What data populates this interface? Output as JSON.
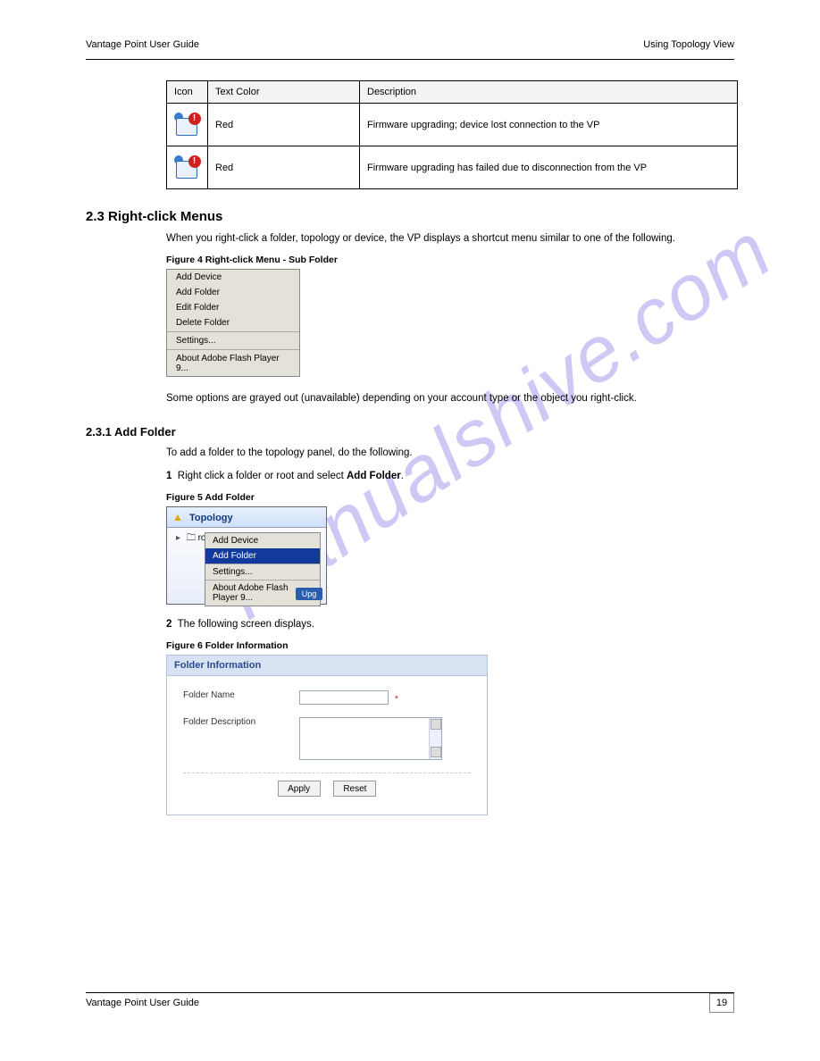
{
  "header": {
    "left": "Vantage Point User Guide",
    "right": "Using Topology View"
  },
  "footer": {
    "left": "Vantage Point User Guide",
    "pageno": "19"
  },
  "table": {
    "h1": "Icon",
    "h2": "Text Color",
    "h3": "Description",
    "rows": [
      {
        "c2": "Red",
        "c3": "Firmware upgrading; device lost connection to the VP"
      },
      {
        "c2": "Red",
        "c3": "Firmware upgrading has failed due to disconnection from the VP"
      }
    ]
  },
  "sec2_3": {
    "title": "2.3  Right-click Menus",
    "para1": "When you right-click a folder, topology or device, the VP displays a shortcut menu similar to one of the following.",
    "fig4_cap": "Figure 4   Right-click Menu - Sub Folder",
    "fig4_menu": [
      "Add Device",
      "Add Folder",
      "Edit Folder",
      "Delete Folder",
      "Settings...",
      "About Adobe Flash Player 9..."
    ],
    "para2": "Some options are grayed out (unavailable) depending on your account type or the object you right-click."
  },
  "sec2_3_1": {
    "title": "2.3.1  Add Folder",
    "para1": "To add a folder to the topology panel, do the following.",
    "step1_no": "1",
    "step1_txt": "Right click a folder or root and select Add Folder.",
    "step1_bold": "Add Folder",
    "fig5_cap": "Figure 5   Add Folder",
    "panel_title": "Topology",
    "panel_root": "root",
    "fig5_menu": {
      "item1": "Add Device",
      "highlight": "Add Folder",
      "item2": "Settings...",
      "item3": "About Adobe Flash Player 9..."
    },
    "panel_upg": "Upg",
    "step2_no": "2",
    "step2_txt": "The following screen displays.",
    "fig6_cap": "Figure 6   Folder Information",
    "form": {
      "header": "Folder Information",
      "name_lbl": "Folder Name",
      "desc_lbl": "Folder Description",
      "apply": "Apply",
      "reset": "Reset",
      "name_placeholder": "",
      "desc_placeholder": ""
    }
  },
  "watermark": "manualshive.com"
}
